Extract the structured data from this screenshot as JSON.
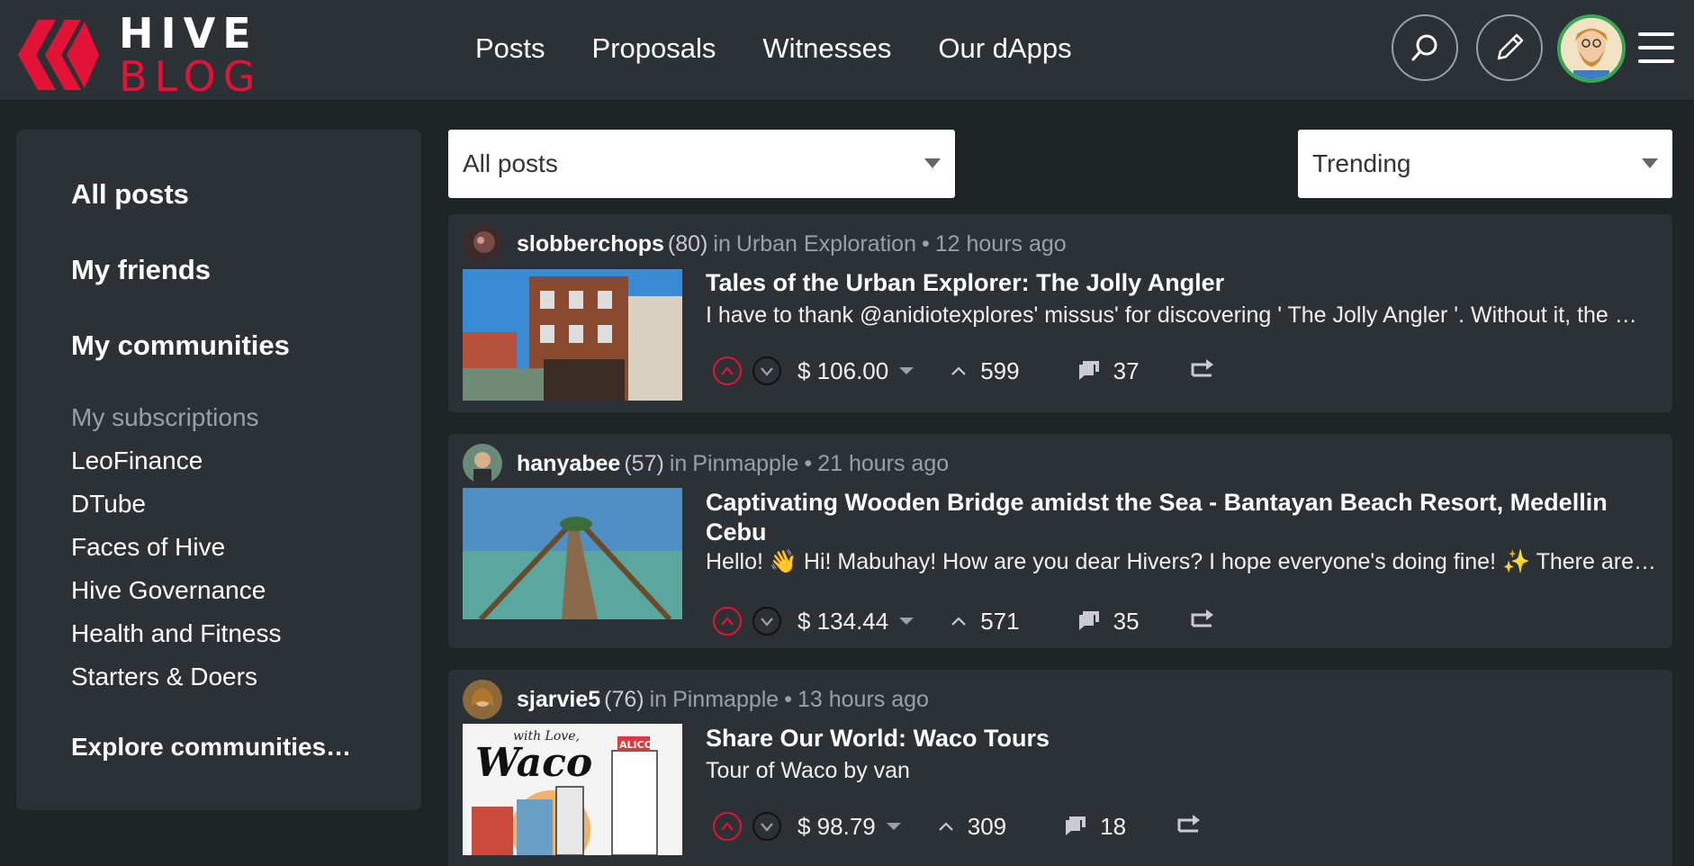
{
  "brand": {
    "line1": "HIVE",
    "line2": "BLOG",
    "color": "#e31337"
  },
  "nav": [
    "Posts",
    "Proposals",
    "Witnesses",
    "Our dApps"
  ],
  "header_icons": [
    "search-icon",
    "pencil-icon",
    "user-avatar",
    "menu-icon"
  ],
  "sidebar": {
    "all_posts": "All posts",
    "my_friends": "My friends",
    "my_communities": "My communities",
    "subscriptions_heading": "My subscriptions",
    "subscriptions": [
      "LeoFinance",
      "DTube",
      "Faces of Hive",
      "Hive Governance",
      "Health and Fitness",
      "Starters & Doers"
    ],
    "explore": "Explore communities…"
  },
  "filters": {
    "feed": "All posts",
    "sort": "Trending"
  },
  "posts": [
    {
      "author": "slobberchops",
      "rep": "(80)",
      "in": "in",
      "community": "Urban Exploration",
      "sep": "•",
      "time": "12 hours ago",
      "title": "Tales of the Urban Explorer: The Jolly Angler",
      "body": "I have to thank @anidiotexplores' missus' for discovering ' The Jolly Angler '. Without it, the …",
      "payout": "$ 106.00",
      "votes": "599",
      "comments": "37"
    },
    {
      "author": "hanyabee",
      "rep": "(57)",
      "in": "in",
      "community": "Pinmapple",
      "sep": "•",
      "time": "21 hours ago",
      "title": "Captivating Wooden Bridge amidst the Sea - Bantayan Beach Resort, Medellin Cebu",
      "body": "Hello! 👋 Hi! Mabuhay! How are you dear Hivers? I hope everyone's doing fine! ✨ There are …",
      "payout": "$ 134.44",
      "votes": "571",
      "comments": "35"
    },
    {
      "author": "sjarvie5",
      "rep": "(76)",
      "in": "in",
      "community": "Pinmapple",
      "sep": "•",
      "time": "13 hours ago",
      "title": "Share Our World: Waco Tours",
      "body": "Tour of Waco by van",
      "payout": "$ 98.79",
      "votes": "309",
      "comments": "18",
      "thumb_text": {
        "script": "with Love,",
        "word": "Waco",
        "sign": "ALICO"
      }
    }
  ]
}
